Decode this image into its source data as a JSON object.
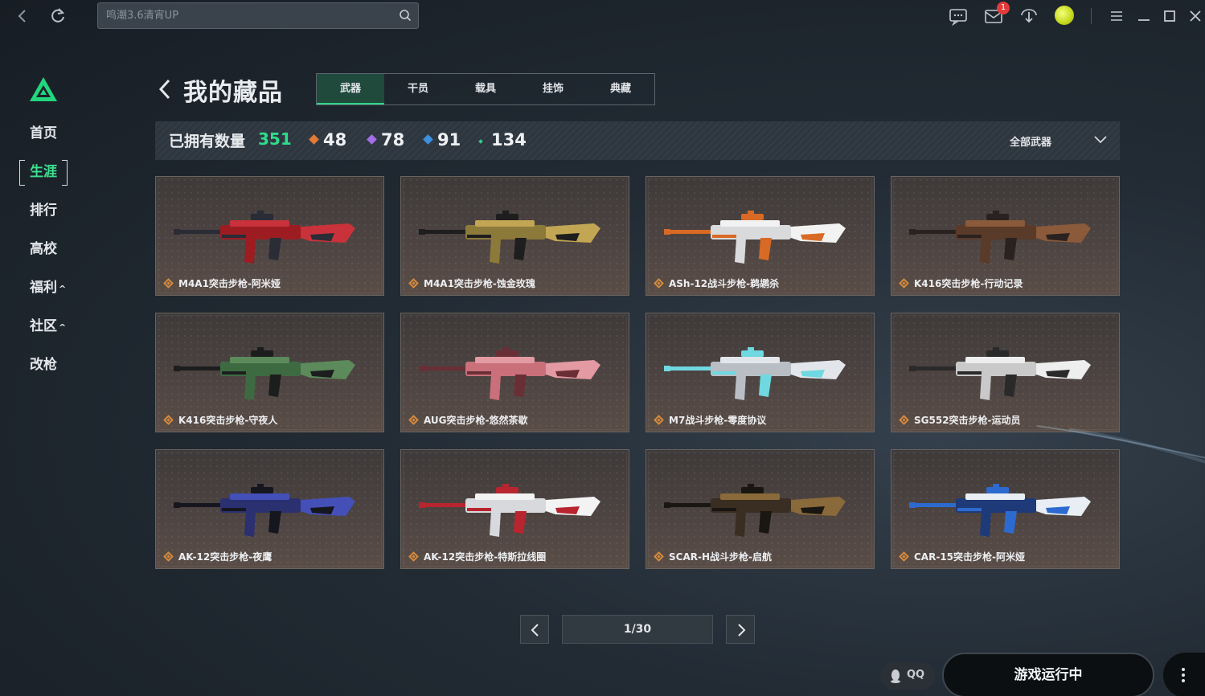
{
  "topbar": {
    "search_placeholder": "鸣潮3.6清宵UP",
    "mail_badge": "1",
    "icons": [
      "back-icon",
      "refresh-icon",
      "search-icon",
      "chat-icon",
      "mail-icon",
      "download-icon",
      "avatar",
      "menu-icon",
      "minimize-icon",
      "maximize-icon",
      "close-icon"
    ]
  },
  "sidebar": {
    "items": [
      {
        "label": "首页",
        "caret": ""
      },
      {
        "label": "生涯",
        "caret": "",
        "active": true
      },
      {
        "label": "排行",
        "caret": ""
      },
      {
        "label": "高校",
        "caret": ""
      },
      {
        "label": "福利",
        "caret": "^"
      },
      {
        "label": "社区",
        "caret": "^"
      },
      {
        "label": "改枪",
        "caret": ""
      }
    ],
    "accent": "#3ee08f"
  },
  "header": {
    "title": "我的藏品",
    "tabs": [
      "武器",
      "干员",
      "载具",
      "挂饰",
      "典藏"
    ],
    "active_tab": "武器"
  },
  "stats": {
    "owned_label": "已拥有数量",
    "owned_count": "351",
    "rarity_counts": [
      {
        "value": "48",
        "color": "#e07a35"
      },
      {
        "value": "78",
        "color": "#a46ee6"
      },
      {
        "value": "91",
        "color": "#3d8fe0"
      },
      {
        "value": "134",
        "color": "#34c98a"
      }
    ],
    "filter_label": "全部武器"
  },
  "cards": [
    {
      "name": "M4A1突击步枪-阿米娅",
      "palette": [
        "#9c1c22",
        "#c9323a",
        "#2a2c36"
      ]
    },
    {
      "name": "M4A1突击步枪-蚀金玫瑰",
      "palette": [
        "#8c7a3a",
        "#c2a653",
        "#1e1e1e"
      ]
    },
    {
      "name": "ASh-12战斗步枪-鹈鹕杀",
      "palette": [
        "#d9dadc",
        "#f2f2f2",
        "#d86a25"
      ]
    },
    {
      "name": "K416突击步枪-行动记录",
      "palette": [
        "#5a3a28",
        "#8b5a3a",
        "#2a2220"
      ]
    },
    {
      "name": "K416突击步枪-守夜人",
      "palette": [
        "#3e6a42",
        "#5c8a5a",
        "#1c1e1e"
      ]
    },
    {
      "name": "AUG突击步枪-悠然茶歇",
      "palette": [
        "#c9707a",
        "#e39aa2",
        "#6a2f36"
      ]
    },
    {
      "name": "M7战斗步枪-零度协议",
      "palette": [
        "#b9bdc4",
        "#e2e6ea",
        "#6fd8e0"
      ]
    },
    {
      "name": "SG552突击步枪-运动员",
      "palette": [
        "#c9c9c9",
        "#eeeeee",
        "#2a2a2a"
      ]
    },
    {
      "name": "AK-12突击步枪-夜鹰",
      "palette": [
        "#2a3070",
        "#4450b8",
        "#16161e"
      ]
    },
    {
      "name": "AK-12突击步枪-特斯拉线圈",
      "palette": [
        "#d7d9dc",
        "#f3f3f3",
        "#b8252f"
      ]
    },
    {
      "name": "SCAR-H战斗步枪-启航",
      "palette": [
        "#3a2e22",
        "#8a6a3a",
        "#1a1612"
      ]
    },
    {
      "name": "CAR-15突击步枪-阿米娅",
      "palette": [
        "#1e3a78",
        "#e8eef4",
        "#2d6ad0"
      ]
    }
  ],
  "pagination": {
    "current": "1/30"
  },
  "footer": {
    "qq_label": "QQ",
    "run_label": "游戏运行中"
  }
}
